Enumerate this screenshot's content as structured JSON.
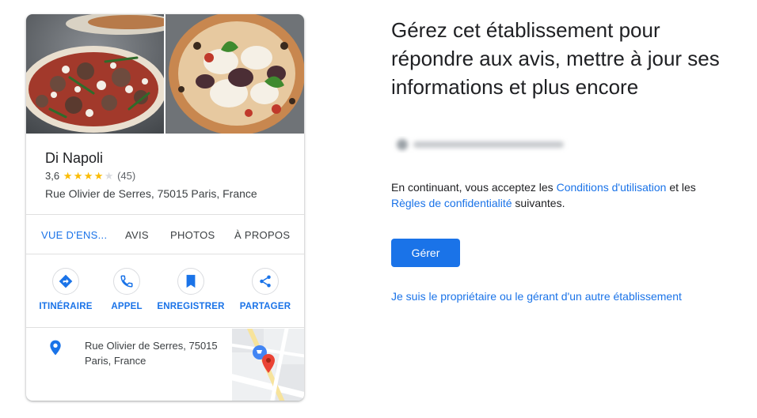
{
  "business": {
    "name": "Di Napoli",
    "rating": "3,6",
    "rating_value": 3.6,
    "review_count": "(45)",
    "address": "Rue Olivier de Serres, 75015 Paris, France",
    "photos": [
      {
        "alt": "pizza-photo-1"
      },
      {
        "alt": "pizza-photo-2"
      }
    ]
  },
  "tabs": {
    "overview": "VUE D'ENS...",
    "reviews": "AVIS",
    "photos": "PHOTOS",
    "about": "À PROPOS"
  },
  "actions": {
    "directions": "ITINÉRAIRE",
    "call": "APPEL",
    "save": "ENREGISTRER",
    "share": "PARTAGER"
  },
  "map_panel": {
    "address_line1": "Rue Olivier de Serres, 75015",
    "address_line2": "Paris, France"
  },
  "manage": {
    "heading": "Gérez cet établissement pour répondre aux avis, mettre à jour ses informations et plus encore",
    "consent_prefix": "En continuant, vous acceptez les ",
    "terms_link": "Conditions d'utilisation",
    "consent_middle": " et les ",
    "privacy_link": "Règles de confidentialité",
    "consent_suffix": " suivantes.",
    "manage_button": "Gérer",
    "other_business_link": "Je suis le propriétaire ou le gérant d'un autre établissement"
  },
  "colors": {
    "accent": "#1a73e8",
    "star": "#fbbc04",
    "map_pin": "#ea4335"
  },
  "icons": [
    "directions-icon",
    "phone-icon",
    "bookmark-icon",
    "share-icon",
    "location-pin-icon",
    "map-thumbnail"
  ]
}
